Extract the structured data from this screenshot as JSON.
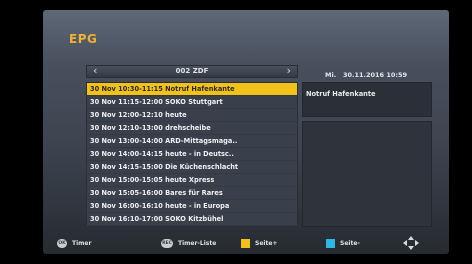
{
  "window": {
    "title": "EPG"
  },
  "channel": {
    "name": "002 ZDF",
    "prev_symbol": "‹",
    "next_symbol": "›"
  },
  "datetime": "Mi.   30.11.2016 10:59",
  "epg_list": [
    {
      "text": "30 Nov 10:30-11:15  Notruf Hafenkante",
      "selected": true
    },
    {
      "text": "30 Nov 11:15-12:00  SOKO Stuttgart",
      "selected": false
    },
    {
      "text": "30 Nov 12:00-12:10  heute",
      "selected": false
    },
    {
      "text": "30 Nov 12:10-13:00  drehscheibe",
      "selected": false
    },
    {
      "text": "30 Nov 13:00-14:00  ARD-Mittagsmaga..",
      "selected": false
    },
    {
      "text": "30 Nov 14:00-14:15  heute - in Deutsc..",
      "selected": false
    },
    {
      "text": "30 Nov 14:15-15:00  Die Küchenschlacht",
      "selected": false
    },
    {
      "text": "30 Nov 15:00-15:05  heute Xpress",
      "selected": false
    },
    {
      "text": "30 Nov 15:05-16:00  Bares für Rares",
      "selected": false
    },
    {
      "text": "30 Nov 16:00-16:10  heute - in Europa",
      "selected": false
    },
    {
      "text": "30 Nov 16:10-17:00  SOKO Kitzbühel",
      "selected": false
    }
  ],
  "detail": {
    "title": "Notruf Hafenkante"
  },
  "footer": {
    "timer": {
      "key": "OK",
      "label": "Timer"
    },
    "timer_list": {
      "key": "REC",
      "label": "Timer-Liste"
    },
    "page_plus": {
      "label": "Seite+",
      "color": "#f2c21a"
    },
    "page_minus": {
      "label": "Seite-",
      "color": "#2fb6e8"
    }
  },
  "colors": {
    "accent": "#f0b230",
    "selection": "#f2c21a"
  }
}
